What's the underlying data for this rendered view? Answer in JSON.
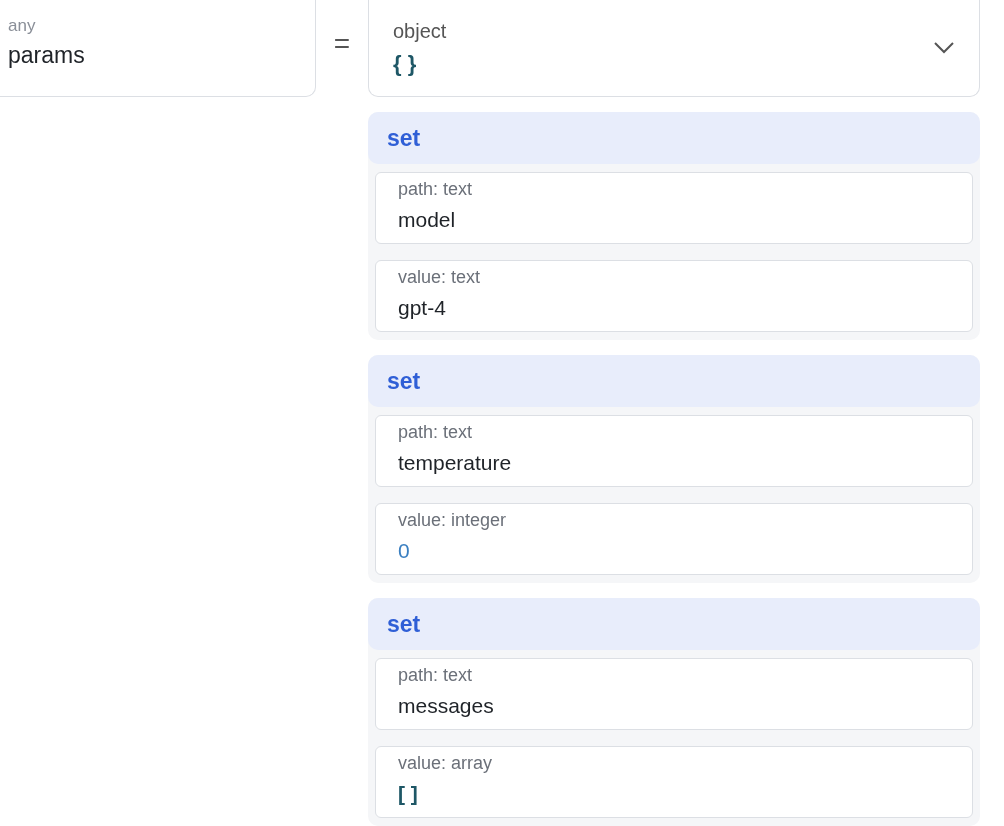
{
  "param": {
    "type": "any",
    "name": "params"
  },
  "operator": "=",
  "value": {
    "type": "object",
    "display": "{ }"
  },
  "operations": [
    {
      "title": "set",
      "fields": [
        {
          "label": "path: text",
          "kind": "text",
          "value": "model"
        },
        {
          "label": "value: text",
          "kind": "text",
          "value": "gpt-4"
        }
      ]
    },
    {
      "title": "set",
      "fields": [
        {
          "label": "path: text",
          "kind": "text",
          "value": "temperature"
        },
        {
          "label": "value: integer",
          "kind": "number",
          "value": "0"
        }
      ]
    },
    {
      "title": "set",
      "fields": [
        {
          "label": "path: text",
          "kind": "text",
          "value": "messages"
        },
        {
          "label": "value: array",
          "kind": "literal",
          "value": "[ ]"
        }
      ]
    }
  ]
}
